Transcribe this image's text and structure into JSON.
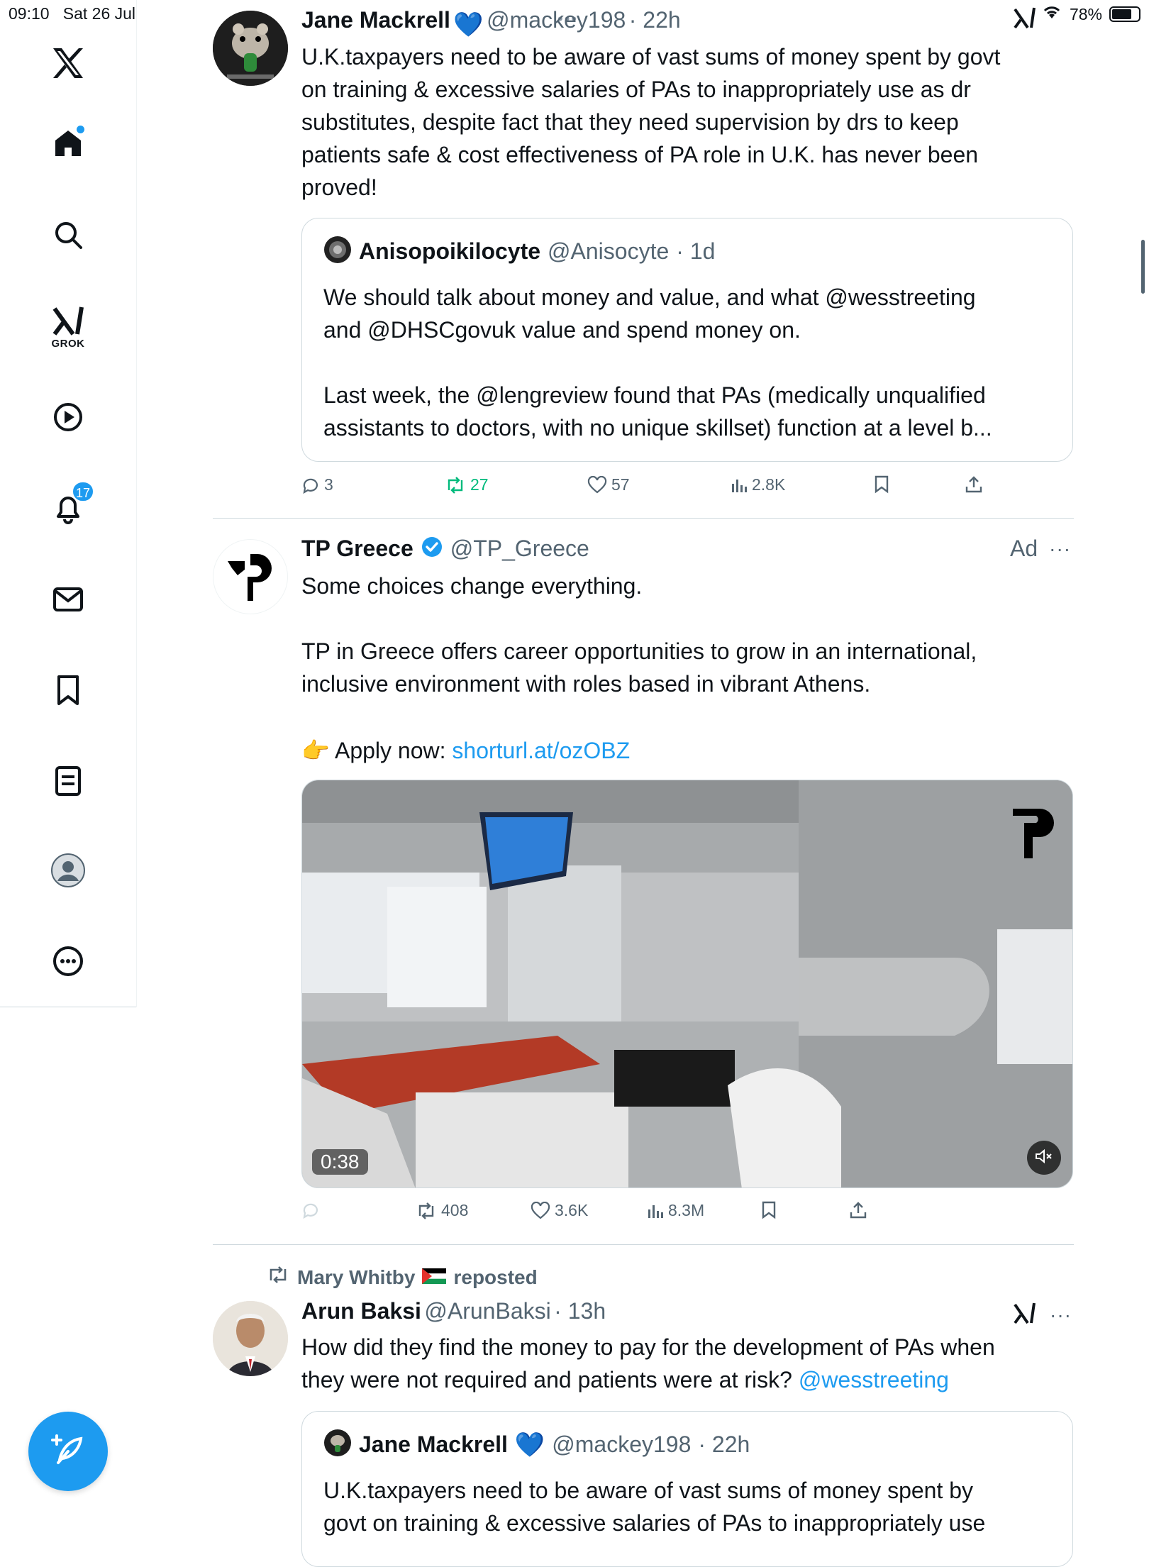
{
  "status_bar": {
    "time": "09:10",
    "date": "Sat 26 Jul",
    "battery": "78%",
    "battery_level": 0.78
  },
  "sidebar": {
    "items": [
      {
        "name": "x-logo-icon"
      },
      {
        "name": "home-icon"
      },
      {
        "name": "search-icon"
      },
      {
        "name": "grok-icon",
        "label": "GROK"
      },
      {
        "name": "video-icon"
      },
      {
        "name": "notifications-icon",
        "badge": "17"
      },
      {
        "name": "messages-icon"
      },
      {
        "name": "bookmarks-icon"
      },
      {
        "name": "lists-icon"
      },
      {
        "name": "profile-icon"
      },
      {
        "name": "more-icon"
      }
    ],
    "compose_icon": "compose-feather-icon"
  },
  "tweets": [
    {
      "name": "Jane Mackrell",
      "handle": "@mackey198",
      "time": "· 22h",
      "text": "U.K.taxpayers need to be aware of vast sums of money spent by govt\non training & excessive salaries of PAs to inappropriately use as dr\nsubstitutes, despite fact that they need supervision by drs to keep\npatients safe & cost effectiveness of PA role in U.K. has never been\nproved!",
      "quote": {
        "name": "Anisopoikilocyte",
        "handle": "@Anisocyte",
        "time": "· 1d",
        "text": "We should talk about money and value, and what @wesstreeting\nand @DHSCgovuk value and spend money on.\n\nLast week, the @lengreview found that PAs (medically unqualified\nassistants to doctors, with no unique skillset) function at a level b..."
      },
      "replies": "3",
      "reposts": "27",
      "likes": "57",
      "views": "2.8K"
    },
    {
      "name": "TP Greece",
      "handle": "@TP_Greece",
      "ad_label": "Ad",
      "text1": "Some choices change everything.\n\nTP in Greece offers career opportunities to grow in an international,\ninclusive environment with roles based in vibrant Athens.",
      "apply_prefix": "Apply now: ",
      "apply_link": "shorturl.at/ozOBZ",
      "video_time": "0:38",
      "reposts": "408",
      "likes": "3.6K",
      "views": "8.3M"
    },
    {
      "repost_by": "Mary Whitby",
      "repost_suffix": "reposted",
      "name": "Arun Baksi",
      "handle": "@ArunBaksi",
      "time": "· 13h",
      "text": "How did they find the money to pay for the development of PAs when\nthey were not required and patients were at risk? ",
      "mention": "@wesstreeting",
      "quote": {
        "name": "Jane Mackrell",
        "handle": "@mackey198",
        "time": "· 22h",
        "text": "U.K.taxpayers need to be aware of vast sums of money spent by\ngovt on training & excessive salaries of PAs to inappropriately use"
      }
    }
  ],
  "colors": {
    "accent": "#1d9bf0",
    "repost_green": "#00ba7c",
    "muted": "#536471",
    "border": "#cfd9de"
  }
}
